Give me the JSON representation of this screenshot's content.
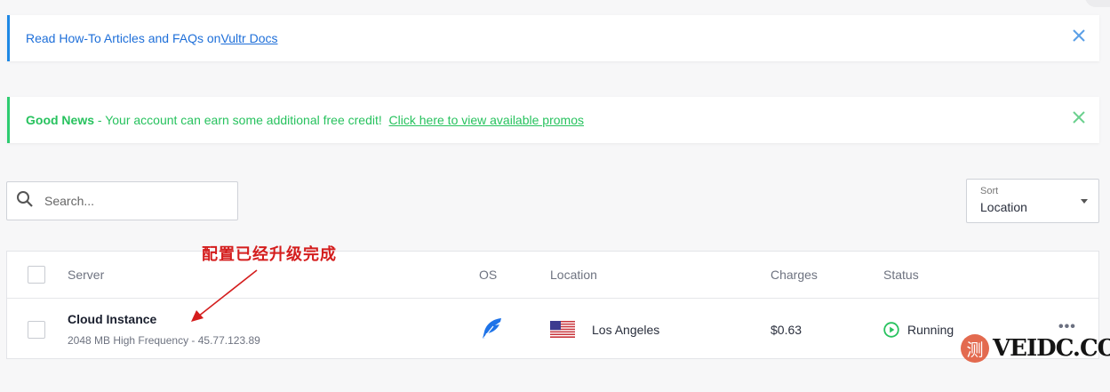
{
  "notices": {
    "info": {
      "text": "Read How-To Articles and FAQs on ",
      "link": "Vultr Docs"
    },
    "promo": {
      "strong": "Good News",
      "text": " - Your account can earn some additional free credit!  ",
      "link": "Click here to view available promos"
    }
  },
  "search": {
    "placeholder": "Search..."
  },
  "sort": {
    "label": "Sort",
    "value": "Location"
  },
  "table": {
    "headers": {
      "server": "Server",
      "os": "OS",
      "location": "Location",
      "charges": "Charges",
      "status": "Status"
    },
    "rows": [
      {
        "name": "Cloud Instance",
        "details": "2048 MB High Frequency - 45.77.123.89",
        "os_icon": "feather-icon",
        "location": "Los Angeles",
        "flag": "us-flag-icon",
        "charges": "$0.63",
        "status": "Running",
        "more": "•••"
      }
    ]
  },
  "annotation": "配置已经升级完成",
  "watermark": {
    "badge": "测",
    "text": "VEIDC.COM"
  },
  "colors": {
    "info": "#1e88e5",
    "success": "#2ecc71",
    "running": "#27c25e",
    "annotation": "#d41d1d",
    "os_icon": "#1e73e8"
  }
}
